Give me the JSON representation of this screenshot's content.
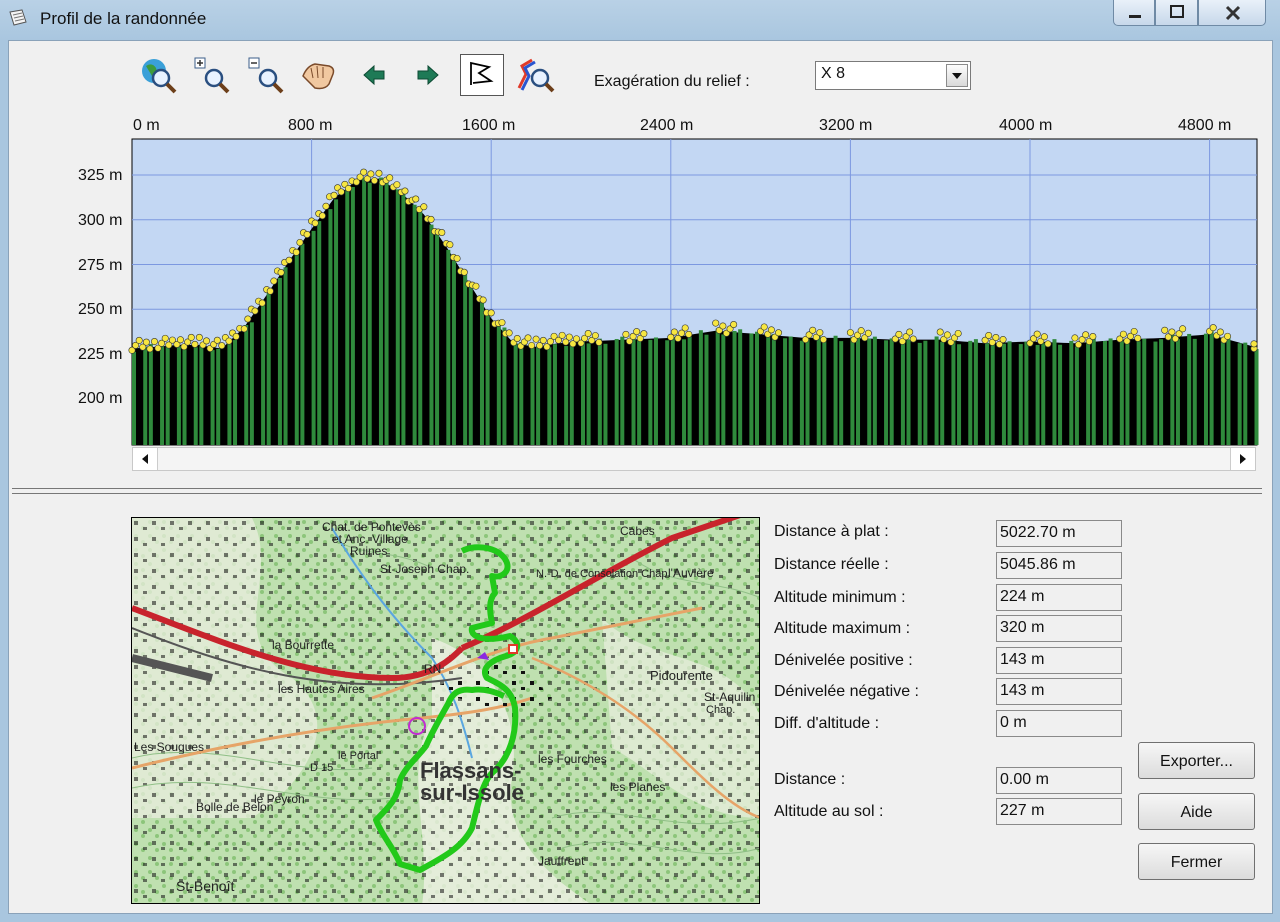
{
  "window": {
    "title": "Profil de la randonnée"
  },
  "toolbar": {
    "icons": [
      "globe-zoom-icon",
      "zoom-in-icon",
      "zoom-out-icon",
      "pan-hand-icon",
      "arrow-left-icon",
      "arrow-right-icon",
      "profile-select-icon",
      "route-zoom-icon"
    ],
    "exaggeration_label": "Exagération du relief :",
    "exaggeration_value": "X 8"
  },
  "chart_data": {
    "type": "bar",
    "x_tick_labels": [
      "0 m",
      "800 m",
      "1600 m",
      "2400 m",
      "3200 m",
      "4000 m",
      "4800 m"
    ],
    "y_tick_labels": [
      "325 m",
      "300 m",
      "275 m",
      "250 m",
      "225 m",
      "200 m"
    ],
    "x": [
      0,
      100,
      200,
      300,
      400,
      500,
      600,
      700,
      800,
      900,
      1000,
      1100,
      1200,
      1300,
      1400,
      1500,
      1600,
      1700,
      1800,
      1900,
      2000,
      2200,
      2400,
      2600,
      2800,
      3000,
      3200,
      3400,
      3600,
      3800,
      4000,
      4200,
      4400,
      4600,
      4800,
      5000
    ],
    "values": [
      228,
      229,
      230,
      230,
      228,
      240,
      258,
      277,
      295,
      312,
      322,
      323,
      315,
      303,
      285,
      265,
      245,
      231,
      229,
      231,
      232,
      233,
      234,
      238,
      236,
      234,
      234,
      233,
      233,
      231,
      232,
      231,
      233,
      234,
      236,
      229
    ],
    "xlim": [
      0,
      5022.7
    ],
    "ylim": [
      180,
      345
    ],
    "grid": true,
    "colors": {
      "plot_bg": "#c3d7f3",
      "bar": "#2f8a3c",
      "fill": "#000000",
      "marker": "#f7e641",
      "grid": "#7c98e0"
    }
  },
  "map": {
    "labels": [
      "Chat. de Pontevès",
      "et Anc. Village",
      "Ruines",
      "St-Joseph Chap.",
      "N.-D. de Consolation Chap.",
      "Cabes",
      "l'Auvière",
      "la Bourrette",
      "les Hautes Aires",
      "RN",
      "Pidourente",
      "St-Aquilin",
      "Chap.",
      "Les Souques",
      "le Peyron",
      "Bolle de Belon",
      "Flassans-sur-Issole",
      "les Fourches",
      "les Planes",
      "Jauffrent",
      "St-Benoît",
      "D 15",
      "le Portal"
    ]
  },
  "stats": [
    {
      "label": "Distance à plat :",
      "value": "5022.70 m"
    },
    {
      "label": "Distance réelle :",
      "value": "5045.86 m"
    },
    {
      "label": "Altitude minimum :",
      "value": "224 m"
    },
    {
      "label": "Altitude maximum :",
      "value": "320 m"
    },
    {
      "label": "Dénivelée positive :",
      "value": "143 m"
    },
    {
      "label": "Dénivelée négative :",
      "value": "143 m"
    },
    {
      "label": "Diff. d'altitude :",
      "value": "0 m"
    }
  ],
  "cursor_stats": [
    {
      "label": "Distance :",
      "value": "0.00 m"
    },
    {
      "label": "Altitude au sol :",
      "value": "227 m"
    }
  ],
  "buttons": {
    "export": "Exporter...",
    "help": "Aide",
    "close": "Fermer"
  }
}
